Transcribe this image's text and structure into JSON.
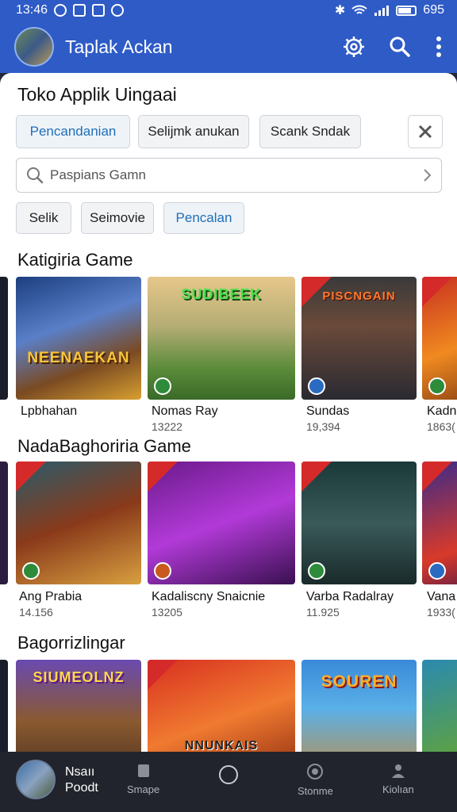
{
  "status_bar": {
    "time": "13:46",
    "battery": "695"
  },
  "app_bar": {
    "title": "Taplak Ackan"
  },
  "store": {
    "title": "Toko Applik Uingaai",
    "chips_row1": [
      "Pencandanian",
      "Selijmk anukan",
      "Scank Sndak"
    ],
    "search_placeholder": "Paspians Gamn",
    "chips_row2": [
      "Selik",
      "Seimovie",
      "Pencalan"
    ]
  },
  "sections": [
    {
      "title": "Katigiria Game",
      "games": [
        {
          "art": "NEENAEKAN",
          "name": "Lpbhahan",
          "count": ""
        },
        {
          "art": "SUDIBEEK",
          "name": "Nomas Ray",
          "count": "13222"
        },
        {
          "art": "PISCNGAIN",
          "name": "Sundas",
          "count": "19,394"
        },
        {
          "art": "",
          "name": "Kadn",
          "count": "1863("
        }
      ]
    },
    {
      "title": "NadaBaghoriria Game",
      "games": [
        {
          "art": "",
          "name": "Ang Prabia",
          "count": "14.156"
        },
        {
          "art": "",
          "name": "Kadaliscny Snaicnie",
          "count": "13205"
        },
        {
          "art": "",
          "name": "Varba Radalray",
          "count": "11.925"
        },
        {
          "art": "",
          "name": "Vana",
          "count": "1933("
        }
      ]
    },
    {
      "title": "Bagorrizlingar",
      "games": [
        {
          "art": "SIUMEOLNZ",
          "name": "",
          "count": ""
        },
        {
          "art": "NNUNKAIS",
          "name": "",
          "count": ""
        },
        {
          "art": "SOUREN",
          "name": "",
          "count": ""
        },
        {
          "art": "",
          "name": "",
          "count": ""
        }
      ]
    }
  ],
  "bottom_nav": {
    "user_line1": "Nsaıı",
    "user_line2": "Poodt",
    "items": [
      "Smape",
      "",
      "Stonme",
      "Kiolıan"
    ]
  },
  "colors": {
    "primary": "#2e5bc6",
    "chip_active_text": "#1f6fb8",
    "nav_bg": "#21242c"
  }
}
